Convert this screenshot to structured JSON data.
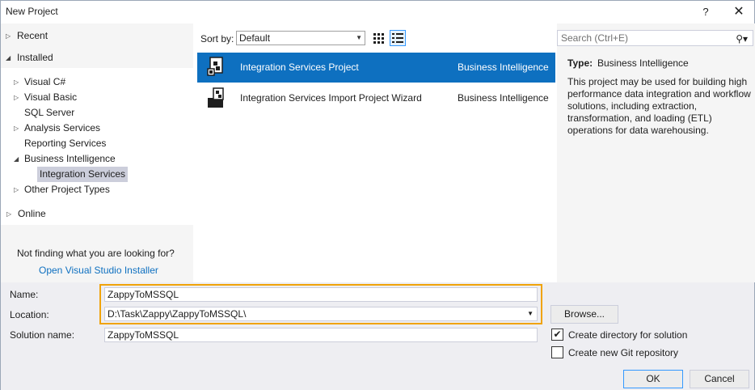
{
  "window": {
    "title": "New Project",
    "help": "?",
    "close": "✕"
  },
  "left": {
    "recent": "Recent",
    "installed": "Installed",
    "online": "Online",
    "tree": [
      {
        "label": "Visual C#"
      },
      {
        "label": "Visual Basic"
      },
      {
        "label": "SQL Server"
      },
      {
        "label": "Analysis Services"
      },
      {
        "label": "Reporting Services"
      },
      {
        "label": "Business Intelligence"
      },
      {
        "label": "Integration Services"
      },
      {
        "label": "Other Project Types"
      }
    ],
    "not_finding": "Not finding what you are looking for?",
    "installer_link": "Open Visual Studio Installer"
  },
  "toolbar": {
    "sort_label": "Sort by:",
    "sort_value": "Default",
    "search_placeholder": "Search (Ctrl+E)"
  },
  "templates": [
    {
      "name": "Integration Services Project",
      "category": "Business Intelligence"
    },
    {
      "name": "Integration Services Import Project Wizard",
      "category": "Business Intelligence"
    }
  ],
  "details": {
    "type_label": "Type:",
    "type_value": "Business Intelligence",
    "description": "This project may be used for building high performance data integration and workflow solutions, including extraction, transformation, and loading (ETL) operations for data warehousing."
  },
  "form": {
    "name_label": "Name:",
    "name_value": "ZappyToMSSQL",
    "location_label": "Location:",
    "location_value": "D:\\Task\\Zappy\\ZappyToMSSQL\\",
    "solution_label": "Solution name:",
    "solution_value": "ZappyToMSSQL",
    "browse": "Browse...",
    "create_dir": "Create directory for solution",
    "create_git": "Create new Git repository",
    "create_dir_checked": true,
    "create_git_checked": false,
    "ok": "OK",
    "cancel": "Cancel"
  },
  "colors": {
    "accent": "#0e70c0",
    "highlight": "#f0a30a",
    "link": "#0e70c0"
  }
}
